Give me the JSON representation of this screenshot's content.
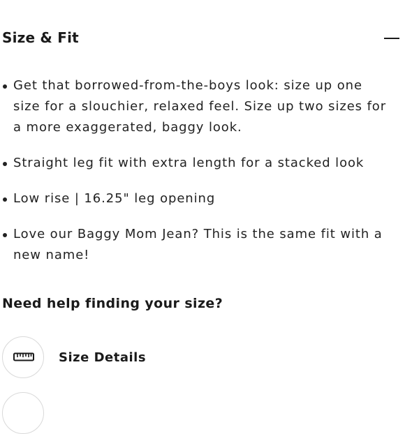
{
  "section": {
    "title": "Size & Fit",
    "toggle_icon": "minus-icon"
  },
  "bullets": [
    {
      "text": "Get that borrowed-from-the-boys look: size up one size for a slouchier, relaxed feel. Size up two sizes for a more exaggerated, baggy look."
    },
    {
      "text": "Straight leg fit with extra length for a stacked look"
    },
    {
      "text": "Low rise | 16.25\" leg opening"
    },
    {
      "text": "Love our Baggy Mom Jean? This is the same fit with a new name!"
    }
  ],
  "help": {
    "title": "Need help finding your size?",
    "size_details": {
      "label": "Size Details",
      "icon": "ruler-icon"
    },
    "next_item_icon": "circle-icon"
  }
}
